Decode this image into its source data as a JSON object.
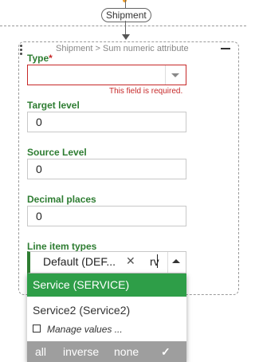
{
  "diagram": {
    "node_label": "Shipment"
  },
  "card": {
    "title": "Shipment > Sum numeric attribute"
  },
  "form": {
    "type": {
      "label": "Type",
      "required_mark": "*",
      "value": "",
      "error": "This field is required."
    },
    "target_level": {
      "label": "Target level",
      "value": "0"
    },
    "source_level": {
      "label": "Source Level",
      "value": "0"
    },
    "decimal_places": {
      "label": "Decimal places",
      "value": "0"
    },
    "line_item_types": {
      "label": "Line item types",
      "chip": "Default (DEF...",
      "chip_remove": "✕",
      "typed_text": "rv"
    }
  },
  "dropdown": {
    "options": [
      {
        "label": "Service (SERVICE)",
        "selected": true
      },
      {
        "label": "Service2 (Service2)",
        "selected": false
      }
    ],
    "manage_values": "Manage values ...",
    "footer": {
      "all": "all",
      "inverse": "inverse",
      "none": "none",
      "confirm": "✓"
    }
  },
  "colors": {
    "accent": "#2e7d32",
    "selected_bg": "#2e9e48",
    "error": "#c62828",
    "footer_bg": "#9e9e9e"
  }
}
